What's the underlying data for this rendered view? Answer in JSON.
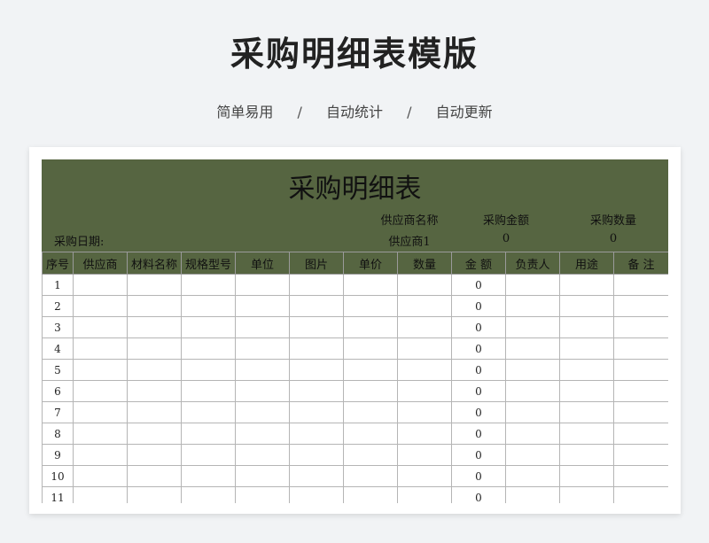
{
  "page": {
    "title": "采购明细表模版",
    "tagline": [
      "简单易用",
      "自动统计",
      "自动更新"
    ],
    "separator": "/"
  },
  "sheet": {
    "title": "采购明细表",
    "date_label": "采购日期:",
    "summary": {
      "supplier_label": "供应商名称",
      "supplier_value": "供应商1",
      "amount_label": "采购金额",
      "amount_value": "0",
      "qty_label": "采购数量",
      "qty_value": "0"
    },
    "columns": [
      "序号",
      "供应商",
      "材料名称",
      "规格型号",
      "单位",
      "图片",
      "单价",
      "数量",
      "金 额",
      "负责人",
      "用途",
      "备 注"
    ],
    "rows": [
      {
        "no": "1",
        "amount": "0"
      },
      {
        "no": "2",
        "amount": "0"
      },
      {
        "no": "3",
        "amount": "0"
      },
      {
        "no": "4",
        "amount": "0"
      },
      {
        "no": "5",
        "amount": "0"
      },
      {
        "no": "6",
        "amount": "0"
      },
      {
        "no": "7",
        "amount": "0"
      },
      {
        "no": "8",
        "amount": "0"
      },
      {
        "no": "9",
        "amount": "0"
      },
      {
        "no": "10",
        "amount": "0"
      },
      {
        "no": "11",
        "amount": "0"
      }
    ]
  },
  "colors": {
    "header_green": "#566541",
    "page_bg": "#f1f3f5"
  }
}
